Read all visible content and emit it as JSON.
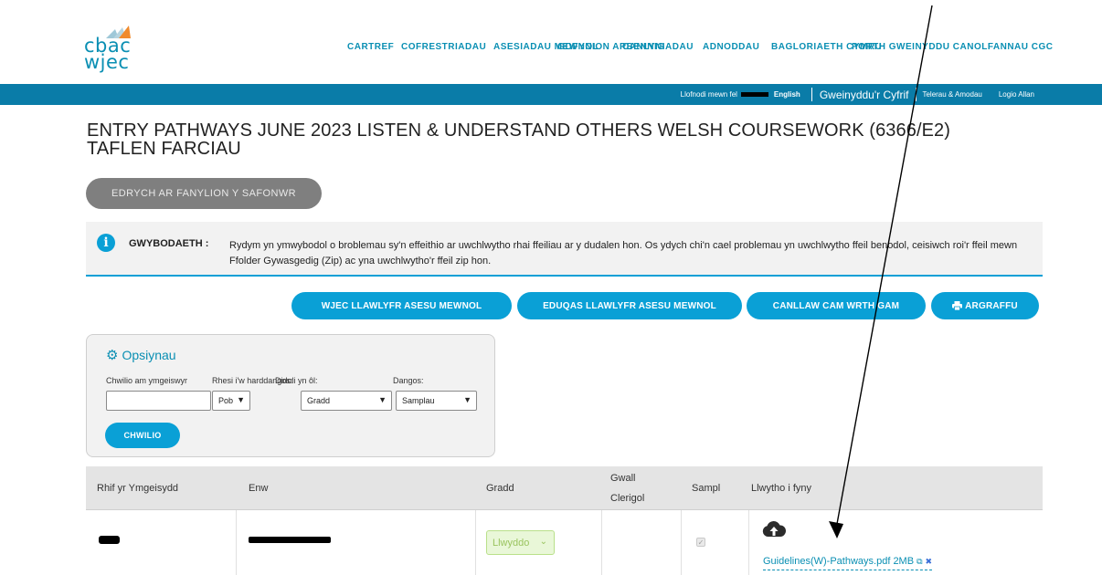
{
  "logo": {
    "line1": "cbac",
    "line2": "wjec"
  },
  "nav": [
    {
      "label": "CARTREF"
    },
    {
      "label": "COFRESTRIADAU"
    },
    {
      "label": "ASESIADAU MEWNOL"
    },
    {
      "label": "GOFYNION ARBENNIG"
    },
    {
      "label": "CANLYNIADAU"
    },
    {
      "label": "ADNODDAU"
    },
    {
      "label": "BAGLORIAETH CYMRU"
    },
    {
      "label": "PORTH GWEINYDDU CANOLFANNAU CGC"
    }
  ],
  "userbar": {
    "signed_in": "Llofnodi mewn fel",
    "english": "English",
    "admin": "Gweinyddu'r Cyfrif",
    "terms": "Telerau & Amodau",
    "logout": "Logio Allan"
  },
  "page_title": "ENTRY PATHWAYS JUNE 2023 LISTEN & UNDERSTAND OTHERS WELSH COURSEWORK (6366/E2) TAFLEN FARCIAU",
  "view_button": "EDRYCH AR FANYLION Y SAFONWR",
  "info": {
    "label": "GWYBODAETH :",
    "text": "Rydym yn ymwybodol o broblemau sy'n effeithio ar uwchlwytho rhai ffeiliau ar y dudalen hon. Os ydych chi'n cael problemau yn uwchlwytho ffeil benodol, ceisiwch roi'r ffeil mewn Ffolder Gywasgedig (Zip) ac yna uwchlwytho'r ffeil zip hon."
  },
  "buttons": {
    "wjec": "WJEC LLAWLYFR ASESU MEWNOL",
    "eduqas": "EDUQAS LLAWLYFR ASESU MEWNOL",
    "guide": "CANLLAW CAM WRTH GAM",
    "print": "ARGRAFFU"
  },
  "options": {
    "heading": "Opsiynau",
    "search_label": "Chwilio am ymgeiswyr",
    "rows_label": "Rhesi i'w harddangos:",
    "sort_label": "Didoli yn ôl:",
    "show_label": "Dangos:",
    "search_value": "",
    "rows_value": "Pob",
    "sort_value": "Gradd",
    "show_value": "Samplau",
    "search_button": "CHWILIO"
  },
  "table": {
    "headers": {
      "candidate_no": "Rhif yr Ymgeisydd",
      "name": "Enw",
      "grade": "Gradd",
      "clerical_error_1": "Gwall",
      "clerical_error_2": "Clerigol",
      "sample": "Sampl",
      "upload": "Llwytho i fyny"
    },
    "rows": [
      {
        "grade": "Llwyddo",
        "sample": true,
        "file": "Guidelines(W)-Pathways.pdf 2MB"
      }
    ]
  },
  "icons": {
    "info": "info-icon",
    "gear": "gear-icon",
    "print": "printer-icon",
    "upload": "cloud-upload-icon",
    "external": "external-link-icon",
    "delete": "close-icon"
  },
  "colors": {
    "brand": "#0a8fb3",
    "bar": "#0a7ca8",
    "button": "#0aa0d6",
    "grey_button": "#7f7f7f",
    "grade_bg": "#e9f7d8"
  }
}
